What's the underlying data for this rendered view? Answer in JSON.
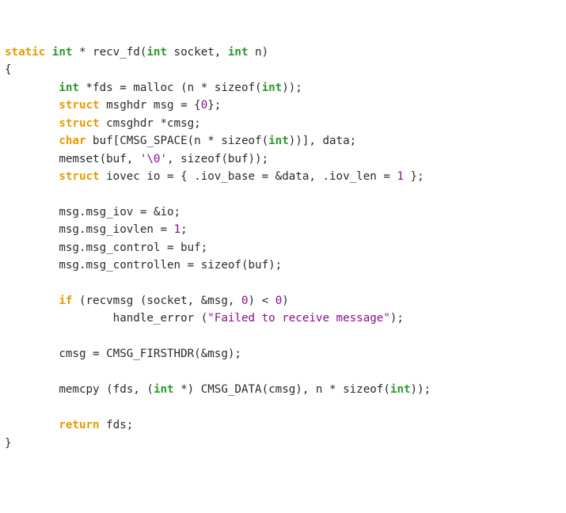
{
  "code": {
    "l1": {
      "kw_static": "static",
      "typ_int": "int",
      "s1": " * recv_fd(",
      "typ_int2": "int",
      "s2": " socket, ",
      "typ_int3": "int",
      "s3": " n)"
    },
    "l2": {
      "brace": "{"
    },
    "l3": {
      "indent": "        ",
      "typ_int": "int",
      "s1": " *fds = malloc (n * sizeof(",
      "typ_int2": "int",
      "s2": "));"
    },
    "l4": {
      "indent": "        ",
      "kw_struct": "struct",
      "s1": " msghdr msg = {",
      "num0": "0",
      "s2": "};"
    },
    "l5": {
      "indent": "        ",
      "kw_struct": "struct",
      "s1": " cmsghdr *cmsg;"
    },
    "l6": {
      "indent": "        ",
      "kw_char": "char",
      "s1": " buf[CMSG_SPACE(n * sizeof(",
      "typ_int": "int",
      "s2": "))], data;"
    },
    "l7": {
      "indent": "        ",
      "s1": "memset(buf, ",
      "chr": "'\\0'",
      "s2": ", sizeof(buf));"
    },
    "l8": {
      "indent": "        ",
      "kw_struct": "struct",
      "s1": " iovec io = { .iov_base = &data, .iov_len = ",
      "num1": "1",
      "s2": " };"
    },
    "l10": {
      "indent": "        ",
      "s1": "msg.msg_iov = &io;"
    },
    "l11": {
      "indent": "        ",
      "s1": "msg.msg_iovlen = ",
      "num1": "1",
      "s2": ";"
    },
    "l12": {
      "indent": "        ",
      "s1": "msg.msg_control = buf;"
    },
    "l13": {
      "indent": "        ",
      "s1": "msg.msg_controllen = sizeof(buf);"
    },
    "l15": {
      "indent": "        ",
      "kw_if": "if",
      "s1": " (recvmsg (socket, &msg, ",
      "num0": "0",
      "s2": ") < ",
      "num0b": "0",
      "s3": ")"
    },
    "l16": {
      "indent": "                ",
      "s1": "handle_error (",
      "str": "\"Failed to receive message\"",
      "s2": ");"
    },
    "l18": {
      "indent": "        ",
      "s1": "cmsg = CMSG_FIRSTHDR(&msg);"
    },
    "l20": {
      "indent": "        ",
      "s1": "memcpy (fds, (",
      "typ_int": "int",
      "s2": " *) CMSG_DATA(cmsg), n * sizeof(",
      "typ_int2": "int",
      "s3": "));"
    },
    "l22": {
      "indent": "        ",
      "kw_return": "return",
      "s1": " fds;"
    },
    "l23": {
      "brace": "}"
    }
  }
}
